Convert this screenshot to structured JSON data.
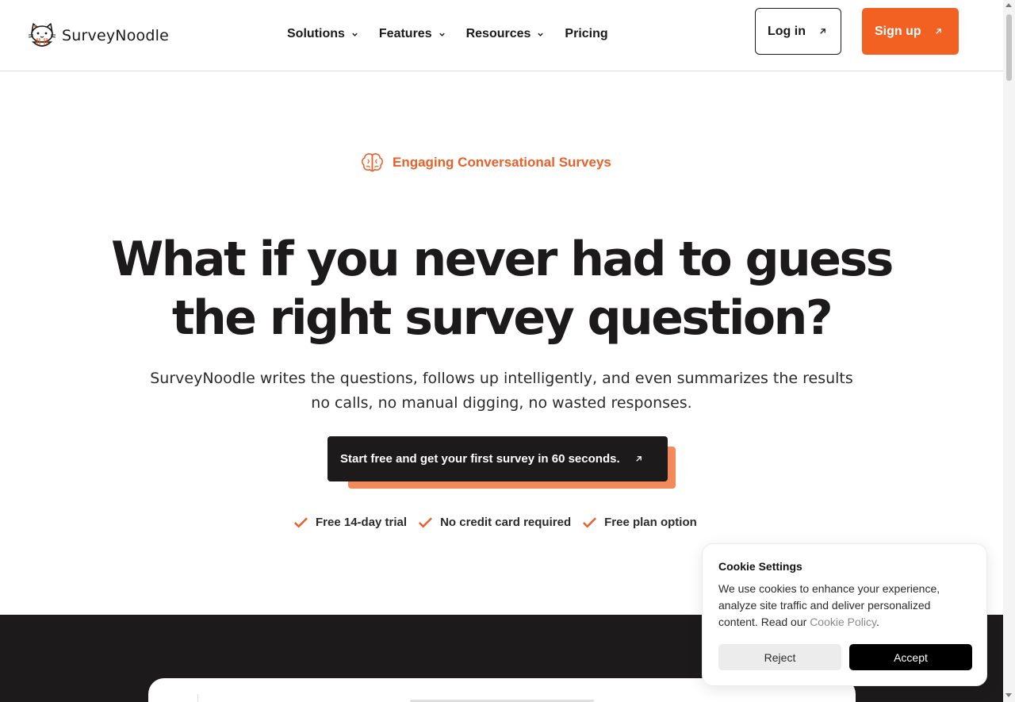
{
  "colors": {
    "accent": "#f26122",
    "accent_soft": "#f4895a",
    "dark": "#1c1a1a"
  },
  "brand": {
    "name": "SurveyNoodle",
    "logo_icon": "cat-noodle-logo"
  },
  "nav": {
    "items": [
      {
        "label": "Solutions",
        "has_dropdown": true
      },
      {
        "label": "Features",
        "has_dropdown": true
      },
      {
        "label": "Resources",
        "has_dropdown": true
      },
      {
        "label": "Pricing",
        "has_dropdown": false
      }
    ],
    "login_label": "Log in",
    "signup_label": "Sign up"
  },
  "hero": {
    "eyebrow": "Engaging Conversational Surveys",
    "eyebrow_icon": "brain-icon",
    "headline_line1": "What if you never had to guess",
    "headline_line2": "the right survey question?",
    "subhead_line1": "SurveyNoodle writes the questions, follows up intelligently, and even summarizes the results",
    "subhead_line2": "no calls, no manual digging, no wasted responses.",
    "cta_label": "Start free and get your first survey in 60 seconds.",
    "checks": [
      "Free 14-day trial",
      "No credit card required",
      "Free plan option"
    ]
  },
  "cookie": {
    "title": "Cookie Settings",
    "text_before_link": "We use cookies to enhance your experience, analyze site traffic and deliver personalized content. Read our ",
    "link_label": "Cookie Policy",
    "text_after_link": ".",
    "reject_label": "Reject",
    "accept_label": "Accept"
  }
}
